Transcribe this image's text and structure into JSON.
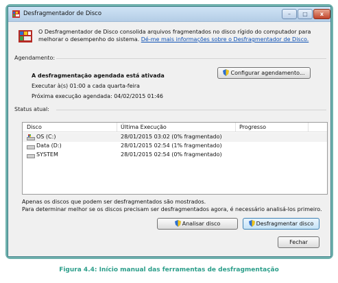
{
  "window": {
    "title": "Desfragmentador de Disco",
    "controls": {
      "minimize": "–",
      "maximize": "□",
      "close": "x"
    }
  },
  "intro": {
    "text": "O Desfragmentador de Disco consolida arquivos fragmentados no disco rígido do computador para melhorar o desempenho do sistema.",
    "link": "Dé-me mais informações sobre o Desfragmentador de Disco."
  },
  "schedule": {
    "section_label": "Agendamento:",
    "status": "A desfragmentação agendada está ativada",
    "run_line": "Executar à(s) 01:00 a cada quarta-feira",
    "next_run": "Próxima execução agendada: 04/02/2015 01:46",
    "configure_button": "Configurar agendamento..."
  },
  "current_status": {
    "section_label": "Status atual:",
    "columns": [
      "Disco",
      "Última Execução",
      "Progresso"
    ],
    "rows": [
      {
        "disk": "OS (C:)",
        "last_run": "28/01/2015 03:02 (0% fragmentado)",
        "progress": "",
        "icon": "system-drive-icon"
      },
      {
        "disk": "Data (D:)",
        "last_run": "28/01/2015 02:54 (1% fragmentado)",
        "progress": "",
        "icon": "drive-icon"
      },
      {
        "disk": "SYSTEM",
        "last_run": "28/01/2015 02:54 (0% fragmentado)",
        "progress": "",
        "icon": "drive-icon"
      }
    ]
  },
  "footer": {
    "note1": "Apenas os discos que podem ser desfragmentados são mostrados.",
    "note2": "Para determinar melhor se os discos precisam ser desfragmentados agora, é necessário analisá-los primeiro.",
    "analyze_button": "Analisar disco",
    "defrag_button": "Desfragmentar disco",
    "close_button": "Fechar"
  },
  "caption": "Figura 4.4: Início manual das ferramentas de desfragmentação",
  "colors": {
    "frame": "#6fb1ad",
    "caption": "#2c9e8a",
    "link": "#0b4fb3"
  }
}
